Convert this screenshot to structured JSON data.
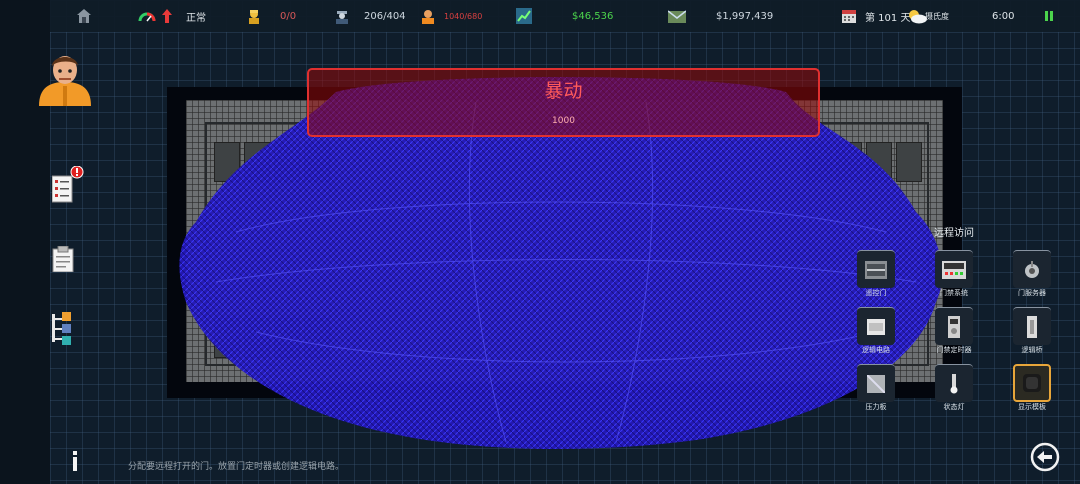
{
  "topbar": {
    "danger_status": "正常",
    "guards": "0/0",
    "staff": "206/404",
    "prisoners": "1040/680",
    "balance": "$46,536",
    "bank": "$1,997,439",
    "day": "第 101 天",
    "weather": "摄氏度",
    "time": "6:00"
  },
  "alert": {
    "title": "暴动",
    "value": "1000"
  },
  "remote_access": {
    "title": "远程访问",
    "tools": [
      {
        "label": "遥控门",
        "icon": "remote-door-icon"
      },
      {
        "label": "门禁系统",
        "icon": "door-control-system-icon"
      },
      {
        "label": "门服务器",
        "icon": "door-server-icon"
      },
      {
        "label": "逻辑电路",
        "icon": "logic-circuit-icon"
      },
      {
        "label": "门禁定时器",
        "icon": "door-timer-icon"
      },
      {
        "label": "逻辑桥",
        "icon": "logic-bridge-icon"
      },
      {
        "label": "压力板",
        "icon": "pressure-plate-icon"
      },
      {
        "label": "状态灯",
        "icon": "status-light-icon"
      },
      {
        "label": "显示模板",
        "icon": "display-template-icon"
      }
    ],
    "selected_index": 8
  },
  "hint": "分配要远程打开的门。放置门定时器或创建逻辑电路。",
  "colors": {
    "alert_red": "#e03030",
    "money_green": "#4cd44c",
    "prisoner_red": "#d84040",
    "riot_blue": "#2a1fb8",
    "avatar_orange": "#f29a28"
  }
}
